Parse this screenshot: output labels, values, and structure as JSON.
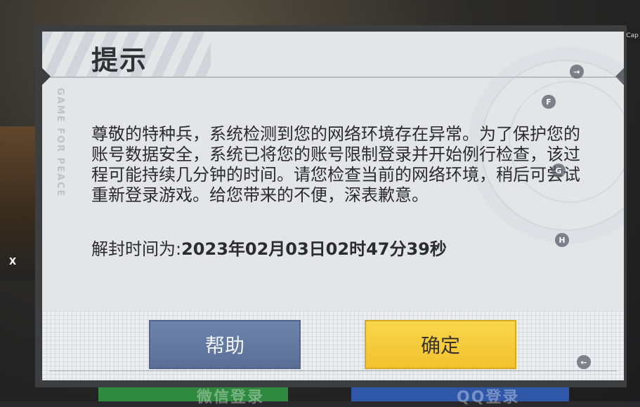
{
  "dialog": {
    "title": "提示",
    "watermark": "GAME FOR PEACE",
    "message": "尊敬的特种兵，系统检测到您的网络环境存在异常。为了保护您的账号数据安全，系统已将您的账号限制登录并开始例行检查，该过程可能持续几分钟的时间。请您检查当前的网络环境，稍后可尝试重新登录游戏。给您带来的不便，深表歉意。",
    "unlock_label": "解封时间为:",
    "unlock_time": "2023年02月03日02时47分39秒",
    "help_label": "帮助",
    "confirm_label": "确定"
  },
  "background": {
    "left_text": "微信登录",
    "right_text": "QQ登录"
  },
  "overlay_hints": {
    "top_right": "→",
    "f": "F",
    "g": "G",
    "h": "H",
    "bottom_right": "←",
    "edge_x": "X",
    "cap": "Cap"
  },
  "colors": {
    "help_button": "#6d84ad",
    "confirm_button": "#f9d74b",
    "dialog_bg": "#e3e5e7"
  }
}
